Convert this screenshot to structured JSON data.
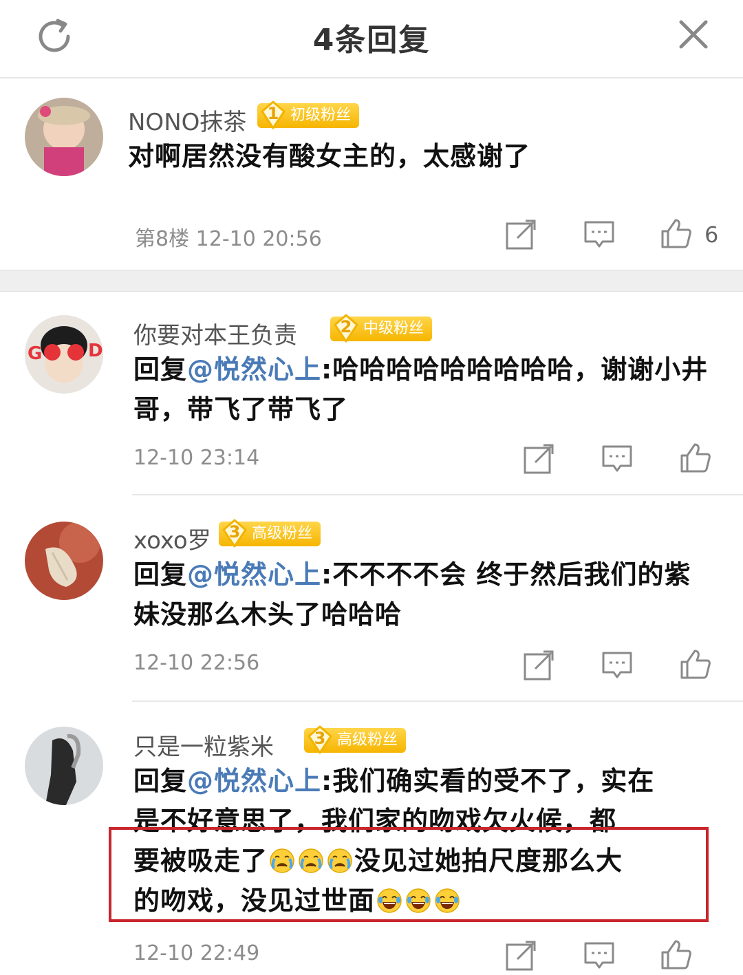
{
  "header": {
    "title": "4条回复",
    "refresh_icon": "refresh-icon",
    "close_icon": "close-icon"
  },
  "comments": [
    {
      "username": "NONO抹茶",
      "badge_level": "1",
      "badge_label": "初级粉丝",
      "text": "对啊居然没有酸女主的，太感谢了",
      "floor": "第8楼",
      "time": "12-10 20:56",
      "likes": "6",
      "avatar_color": "#c98a8f"
    },
    {
      "username": "你要对本王负责",
      "badge_level": "2",
      "badge_label": "中级粉丝",
      "reply_prefix": "回复",
      "mention": "@悦然心上",
      "text": ":哈哈哈哈哈哈哈哈哈，谢谢小井哥，带飞了带飞了",
      "time": "12-10 23:14",
      "avatar_color": "#d7d0c8"
    },
    {
      "username": "xoxo罗",
      "badge_level": "3",
      "badge_label": "高级粉丝",
      "reply_prefix": "回复",
      "mention": "@悦然心上",
      "text": ":不不不不会 终于然后我们的紫妹没那么木头了哈哈哈",
      "time": "12-10 22:56",
      "avatar_color": "#a84432"
    },
    {
      "username": "只是一粒紫米",
      "badge_level": "3",
      "badge_label": "高级粉丝",
      "reply_prefix": "回复",
      "mention": "@悦然心上",
      "text_line1": ":我们确实看的受不了，实在",
      "text_line2": "是不好意思了，我们家的吻戏欠火候，都",
      "text_line3a": "要被吸走了",
      "text_line3b": "没见过她拍尺度那么大",
      "text_line4a": "的吻戏，没见过世面",
      "time": "12-10 22:49",
      "avatar_color": "#7b7b7b"
    }
  ],
  "emojis": {
    "crying": "crying-emoji",
    "laughing": "laughing-emoji"
  },
  "colors": {
    "mention": "#4a7bb7",
    "badge": "#f6b500",
    "highlight_box": "#c9252c"
  }
}
